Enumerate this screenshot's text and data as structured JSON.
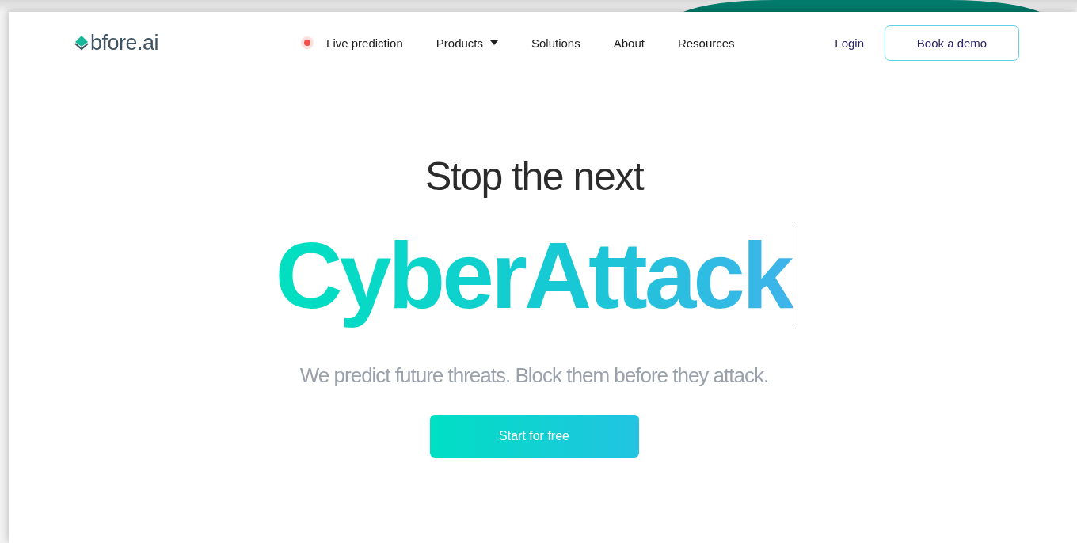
{
  "logo": {
    "text": "bfore.ai"
  },
  "nav": [
    {
      "label": "Live prediction",
      "kind": "live"
    },
    {
      "label": "Products",
      "kind": "dropdown"
    },
    {
      "label": "Solutions",
      "kind": "link"
    },
    {
      "label": "About",
      "kind": "link"
    },
    {
      "label": "Resources",
      "kind": "link"
    }
  ],
  "login": "Login",
  "demo_button": "Book a demo",
  "hero": {
    "title": "Stop the next",
    "highlight": "CyberAttack",
    "subtitle": "We predict future threats. Block them before they attack.",
    "cta": "Start for free"
  }
}
